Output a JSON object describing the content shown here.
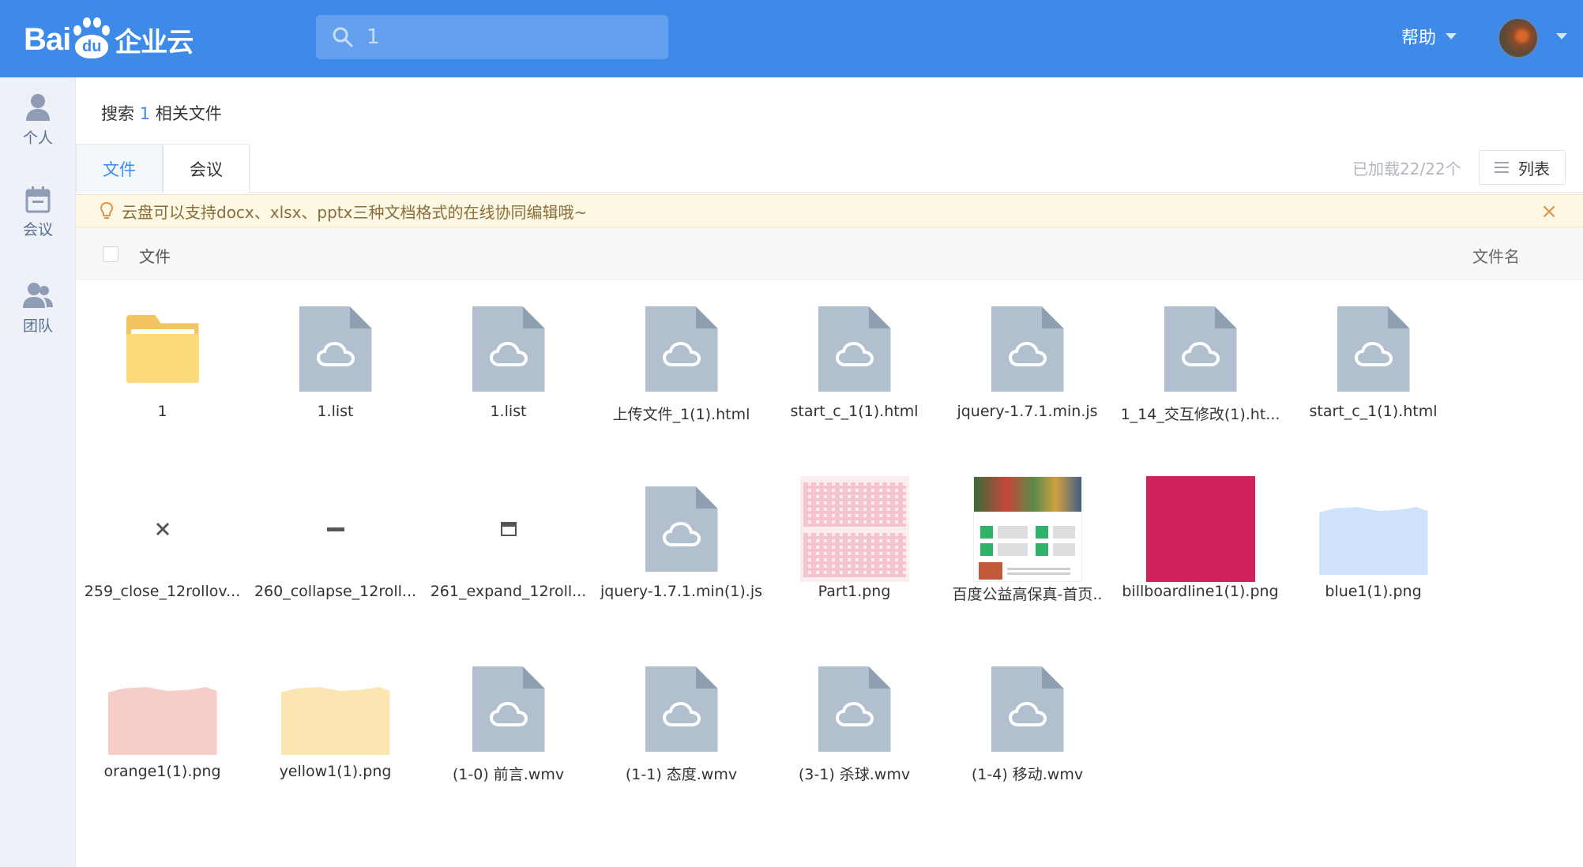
{
  "brand": {
    "logo_text_left": "Bai",
    "logo_text_paw": "du",
    "logo_text_right": "企业云"
  },
  "header": {
    "search_value": "1",
    "help_label": "帮助"
  },
  "sidebar": {
    "items": [
      {
        "label": "个人",
        "icon": "person-icon"
      },
      {
        "label": "会议",
        "icon": "calendar-icon"
      },
      {
        "label": "团队",
        "icon": "team-icon"
      }
    ]
  },
  "search_title": {
    "prefix": "搜索",
    "keyword": "1",
    "suffix": "相关文件"
  },
  "tabs": [
    {
      "label": "文件",
      "active": true
    },
    {
      "label": "会议",
      "active": false
    }
  ],
  "loaded_text": "已加载22/22个",
  "view_button_label": "列表",
  "tip": {
    "text": "云盘可以支持docx、xlsx、pptx三种文档格式的在线协同编辑哦~",
    "close": "×"
  },
  "columns": {
    "file": "文件",
    "filename": "文件名"
  },
  "files": [
    {
      "name": "1",
      "type": "folder"
    },
    {
      "name": "1.list",
      "type": "doc"
    },
    {
      "name": "1.list",
      "type": "doc"
    },
    {
      "name": "上传文件_1(1).html",
      "type": "doc"
    },
    {
      "name": "start_c_1(1).html",
      "type": "doc"
    },
    {
      "name": "jquery-1.7.1.min.js",
      "type": "doc"
    },
    {
      "name": "1_14_交互修改(1).ht...",
      "type": "doc"
    },
    {
      "name": "start_c_1(1).html",
      "type": "doc"
    },
    {
      "name": "259_close_12rollov...",
      "type": "img-close"
    },
    {
      "name": "260_collapse_12roll...",
      "type": "img-collapse"
    },
    {
      "name": "261_expand_12roll...",
      "type": "img-expand"
    },
    {
      "name": "jquery-1.7.1.min(1).js",
      "type": "doc"
    },
    {
      "name": "Part1.png",
      "type": "img-part1"
    },
    {
      "name": "百度公益高保真-首页..",
      "type": "img-shot"
    },
    {
      "name": "billboardline1(1).png",
      "type": "img-magenta"
    },
    {
      "name": "blue1(1).png",
      "type": "img-wave",
      "color": "#cfe2fb"
    },
    {
      "name": "orange1(1).png",
      "type": "img-wave",
      "color": "#f7cdc9"
    },
    {
      "name": "yellow1(1).png",
      "type": "img-wave",
      "color": "#fbe5b0"
    },
    {
      "name": "(1-0) 前言.wmv",
      "type": "doc"
    },
    {
      "name": "(1-1) 态度.wmv",
      "type": "doc"
    },
    {
      "name": "(3-1) 杀球.wmv",
      "type": "doc"
    },
    {
      "name": "(1-4) 移动.wmv",
      "type": "doc"
    }
  ],
  "colors": {
    "header_bg": "#3d8ae8",
    "accent": "#3d8ae8",
    "doc_icon": "#b1bfcf",
    "folder": "#fcd97a",
    "tip_bg": "#fcf8e3",
    "tip_text": "#8a6d3b"
  }
}
